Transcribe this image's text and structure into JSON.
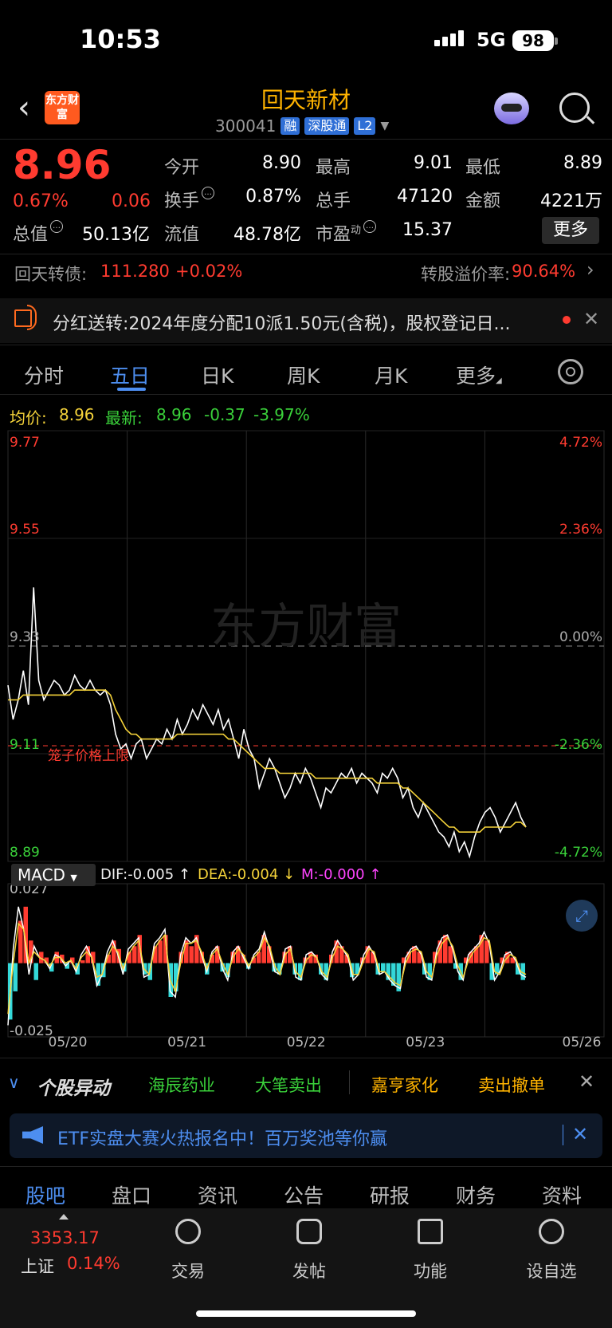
{
  "status": {
    "time": "10:53",
    "network": "5G",
    "battery": "98"
  },
  "header": {
    "logo": "东方财富",
    "name": "回天新材",
    "code": "300041",
    "tags": [
      "融",
      "深股通",
      "L2"
    ]
  },
  "quote": {
    "price": "8.96",
    "change_pct": "0.67%",
    "change": "0.06",
    "open_label": "今开",
    "open": "8.90",
    "high_label": "最高",
    "high": "9.01",
    "low_label": "最低",
    "low": "8.89",
    "turnover_label": "换手",
    "turnover": "0.87%",
    "volume_label": "总手",
    "volume": "47120",
    "amount_label": "金额",
    "amount": "4221万",
    "mcap_label": "总值",
    "mcap": "50.13亿",
    "float_label": "流值",
    "float": "48.78亿",
    "pe_label": "市盈",
    "pe_sup": "动",
    "pe": "15.37",
    "more": "更多"
  },
  "convertible": {
    "label": "回天转债:",
    "price": "111.280",
    "change": "+0.02%",
    "premium_label": "转股溢价率:",
    "premium": "90.64%"
  },
  "notice": {
    "label": "分红送转:",
    "text": "2024年度分配10派1.50元(含税)，股权登记日..."
  },
  "tabs": [
    "分时",
    "五日",
    "日K",
    "周K",
    "月K",
    "更多"
  ],
  "avg_row": {
    "avg_label": "均价:",
    "avg": "8.96",
    "latest_label": "最新:",
    "latest": "8.96",
    "chg": "-0.37",
    "pct": "-3.97%"
  },
  "chart_data": {
    "type": "line",
    "title": "",
    "x_ticks": [
      "05/20",
      "05/21",
      "05/22",
      "05/23",
      "05/26"
    ],
    "y_left_ticks": [
      "9.77",
      "9.55",
      "9.33",
      "9.11",
      "8.89"
    ],
    "y_right_ticks": [
      "4.72%",
      "2.36%",
      "0.00%",
      "-2.36%",
      "-4.72%"
    ],
    "ylim": [
      8.89,
      9.77
    ],
    "prev_close": 9.33,
    "limit_line_label": "笼子价格上限",
    "limit_line_value": "9.11",
    "watermark": "东方财富",
    "series": [
      {
        "values": [
          9.25,
          9.18,
          9.22,
          9.28,
          9.21,
          9.45,
          9.26,
          9.22,
          9.24,
          9.26,
          9.25,
          9.23,
          9.24,
          9.27,
          9.25,
          9.24,
          9.26,
          9.24,
          9.23,
          9.24,
          9.21,
          9.15,
          9.12,
          9.13,
          9.1,
          9.13,
          9.14,
          9.1,
          9.12,
          9.14,
          9.13,
          9.16,
          9.14,
          9.18,
          9.15,
          9.17,
          9.2,
          9.18,
          9.21,
          9.19,
          9.17,
          9.2,
          9.16,
          9.18,
          9.14,
          9.1,
          9.16,
          9.12,
          9.1,
          9.04,
          9.07,
          9.1,
          9.08,
          9.05,
          9.02,
          9.04,
          9.07,
          9.05,
          9.08,
          9.06,
          9.03,
          9.0,
          9.04,
          9.03,
          9.05,
          9.07,
          9.06,
          9.08,
          9.05,
          9.07,
          9.06,
          9.05,
          9.03,
          9.07,
          9.06,
          9.08,
          9.06,
          9.02,
          9.04,
          9.0,
          8.98,
          9.01,
          8.99,
          8.97,
          8.95,
          8.94,
          8.92,
          8.95,
          8.91,
          8.93,
          8.9,
          8.94,
          8.97,
          8.99,
          9.0,
          8.98,
          8.95,
          8.97,
          8.99,
          9.01,
          8.98,
          8.96
        ]
      },
      {
        "values": [
          9.22,
          9.22,
          9.22,
          9.23,
          9.23,
          9.23,
          9.23,
          9.23,
          9.23,
          9.23,
          9.23,
          9.23,
          9.23,
          9.24,
          9.24,
          9.24,
          9.24,
          9.24,
          9.24,
          9.24,
          9.23,
          9.2,
          9.18,
          9.16,
          9.15,
          9.15,
          9.14,
          9.14,
          9.14,
          9.14,
          9.14,
          9.14,
          9.14,
          9.15,
          9.15,
          9.15,
          9.15,
          9.15,
          9.15,
          9.15,
          9.15,
          9.15,
          9.15,
          9.14,
          9.14,
          9.13,
          9.12,
          9.11,
          9.1,
          9.09,
          9.08,
          9.08,
          9.08,
          9.07,
          9.07,
          9.07,
          9.07,
          9.07,
          9.07,
          9.07,
          9.06,
          9.06,
          9.06,
          9.06,
          9.06,
          9.06,
          9.06,
          9.06,
          9.06,
          9.06,
          9.06,
          9.06,
          9.05,
          9.05,
          9.05,
          9.05,
          9.05,
          9.04,
          9.04,
          9.03,
          9.02,
          9.01,
          9.0,
          8.99,
          8.98,
          8.97,
          8.96,
          8.96,
          8.95,
          8.95,
          8.95,
          8.95,
          8.95,
          8.96,
          8.96,
          8.96,
          8.96,
          8.96,
          8.96,
          8.97,
          8.97,
          8.96
        ]
      }
    ],
    "macd": {
      "indicator": "MACD",
      "dif_label": "DIF:-0.005 ↑",
      "dea_label": "DEA:-0.004 ↓",
      "m_label": "M:-0.000 ↑",
      "max_label": "0.027",
      "min_label": "-0.025",
      "ylim": [
        -0.025,
        0.027
      ],
      "hist": [
        -0.02,
        -0.01,
        0.015,
        0.02,
        0.008,
        -0.006,
        0.004,
        0.002,
        -0.003,
        0.004,
        0.003,
        -0.002,
        0.002,
        -0.004,
        0.001,
        0.006,
        0.004,
        -0.008,
        -0.005,
        0.003,
        0.008,
        0.005,
        -0.003,
        0.004,
        0.006,
        0.01,
        -0.004,
        -0.006,
        0.006,
        0.008,
        0.01,
        -0.012,
        -0.01,
        0.004,
        0.008,
        0.006,
        0.01,
        0.004,
        -0.004,
        0.003,
        0.006,
        -0.003,
        -0.005,
        0.004,
        0.006,
        0.003,
        -0.002,
        0.002,
        0.004,
        0.01,
        0.006,
        -0.003,
        -0.004,
        0.004,
        0.006,
        -0.004,
        -0.006,
        0.002,
        0.004,
        0.003,
        -0.004,
        -0.006,
        0.003,
        0.008,
        0.006,
        0.003,
        -0.005,
        -0.004,
        0.002,
        0.006,
        0.004,
        -0.004,
        -0.003,
        -0.006,
        -0.008,
        -0.01,
        0.002,
        0.004,
        0.006,
        0.004,
        -0.004,
        -0.006,
        0.004,
        0.008,
        0.01,
        0.006,
        -0.002,
        -0.006,
        0.002,
        0.004,
        0.006,
        0.01,
        0.008,
        -0.006,
        -0.004,
        0.002,
        0.004,
        0.002,
        -0.004,
        -0.006
      ],
      "dif": [
        -0.022,
        0.005,
        0.02,
        0.012,
        -0.004,
        0.006,
        0.002,
        0.001,
        -0.002,
        0.003,
        0.002,
        -0.001,
        0.001,
        -0.003,
        0.003,
        0.006,
        0.002,
        -0.008,
        -0.004,
        0.004,
        0.008,
        0.003,
        -0.004,
        0.005,
        0.007,
        0.009,
        -0.005,
        -0.004,
        0.007,
        0.009,
        0.012,
        -0.01,
        -0.012,
        0.003,
        0.009,
        0.007,
        0.009,
        0.003,
        -0.003,
        0.004,
        0.006,
        -0.002,
        -0.006,
        0.004,
        0.006,
        0.002,
        -0.002,
        0.003,
        0.005,
        0.011,
        0.005,
        -0.003,
        -0.004,
        0.005,
        0.006,
        -0.005,
        -0.006,
        0.003,
        0.004,
        0.002,
        -0.004,
        -0.006,
        0.004,
        0.008,
        0.005,
        0.002,
        -0.006,
        -0.004,
        0.003,
        0.006,
        0.003,
        -0.004,
        -0.003,
        -0.006,
        -0.008,
        -0.009,
        0.002,
        0.005,
        0.006,
        0.003,
        -0.005,
        -0.006,
        0.005,
        0.009,
        0.01,
        0.005,
        -0.003,
        -0.006,
        0.003,
        0.005,
        0.007,
        0.011,
        0.007,
        -0.006,
        -0.003,
        0.003,
        0.004,
        0.001,
        -0.004,
        -0.005
      ],
      "dea": [
        -0.018,
        0.0,
        0.014,
        0.012,
        0.0,
        0.004,
        0.002,
        0.001,
        -0.001,
        0.002,
        0.002,
        0.0,
        0.001,
        -0.002,
        0.002,
        0.004,
        0.002,
        -0.005,
        -0.004,
        0.002,
        0.006,
        0.004,
        -0.002,
        0.003,
        0.006,
        0.008,
        -0.002,
        -0.004,
        0.005,
        0.008,
        0.01,
        -0.006,
        -0.01,
        0.0,
        0.007,
        0.007,
        0.008,
        0.004,
        -0.002,
        0.003,
        0.005,
        0.0,
        -0.004,
        0.002,
        0.005,
        0.003,
        -0.001,
        0.002,
        0.004,
        0.009,
        0.006,
        -0.001,
        -0.004,
        0.003,
        0.005,
        -0.003,
        -0.005,
        0.001,
        0.003,
        0.002,
        -0.003,
        -0.005,
        0.002,
        0.006,
        0.005,
        0.003,
        -0.004,
        -0.004,
        0.001,
        0.005,
        0.004,
        -0.003,
        -0.003,
        -0.005,
        -0.007,
        -0.008,
        0.0,
        0.004,
        0.005,
        0.004,
        -0.003,
        -0.005,
        0.003,
        0.007,
        0.009,
        0.006,
        -0.001,
        -0.005,
        0.001,
        0.004,
        0.006,
        0.009,
        0.008,
        -0.003,
        -0.004,
        0.001,
        0.003,
        0.002,
        -0.003,
        -0.004
      ]
    }
  },
  "abnormal": {
    "label": "个股异动",
    "items": [
      "海辰药业",
      "大笔卖出",
      "嘉亨家化",
      "卖出撤单"
    ]
  },
  "etf": {
    "text": "ETF实盘大赛火热报名中！百万奖池等你赢"
  },
  "bottom_tabs": [
    "股吧",
    "盘口",
    "资讯",
    "公告",
    "研报",
    "财务",
    "资料"
  ],
  "nav": {
    "index_value": "3353.17",
    "index_name": "上证",
    "index_pct": "0.14%",
    "items": [
      "交易",
      "发帖",
      "功能",
      "设自选"
    ]
  },
  "colors": {
    "up": "#ff3b30",
    "down": "#3ad13a",
    "accent": "#4d8ef0",
    "avg_line": "#f5d33a"
  }
}
